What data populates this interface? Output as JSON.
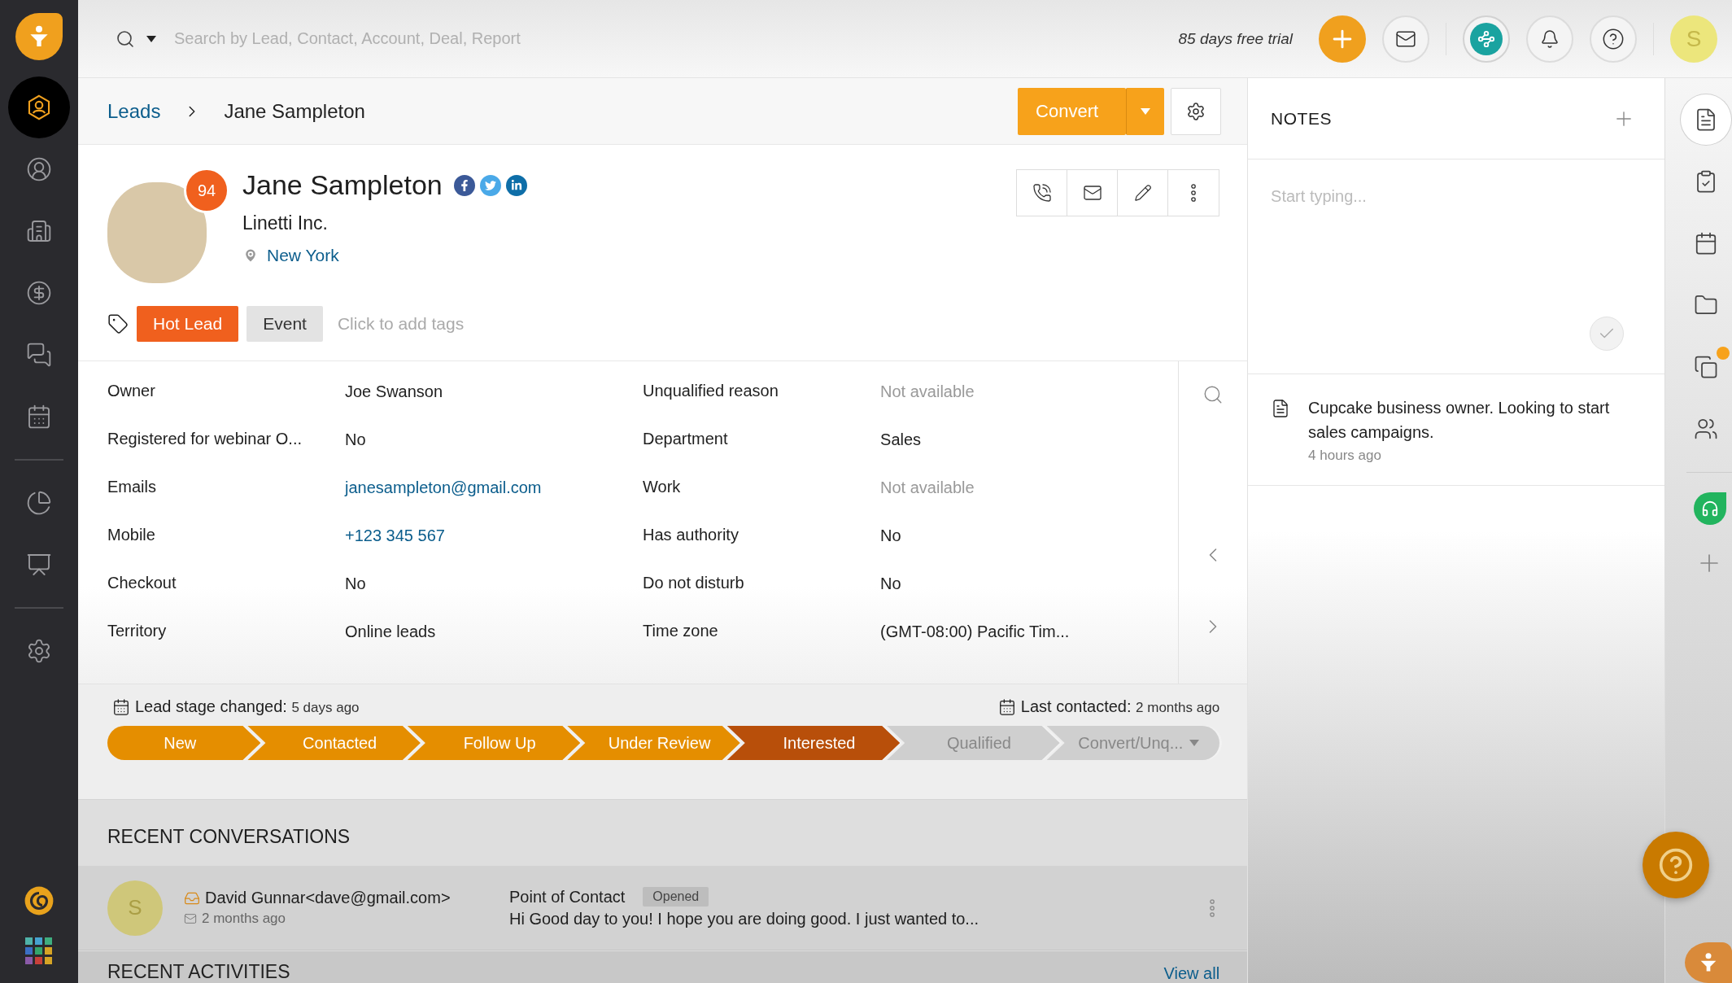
{
  "sidebar": {
    "items": [
      {
        "kind": "leads",
        "selected": true
      },
      {
        "kind": "contacts",
        "selected": false
      },
      {
        "kind": "accounts",
        "selected": false
      },
      {
        "kind": "deals",
        "selected": false
      },
      {
        "kind": "conversations",
        "selected": false
      },
      {
        "kind": "calendar",
        "selected": false
      },
      {
        "kind": "reports",
        "selected": false
      },
      {
        "kind": "analytics",
        "selected": false
      },
      {
        "kind": "settings",
        "selected": false
      }
    ]
  },
  "search": {
    "placeholder": "Search by Lead, Contact, Account, Deal, Report"
  },
  "trial_text": "85 days free trial",
  "user_initial": "S",
  "breadcrumb": [
    "Leads",
    "Jane Sampleton"
  ],
  "convert_button": "Convert",
  "lead": {
    "name": "Jane Sampleton",
    "score": "94",
    "company": "Linetti Inc.",
    "location": "New York"
  },
  "tags": [
    {
      "label": "Hot Lead",
      "color": "#f0601e"
    },
    {
      "label": "Event",
      "color": "#e3e3e3"
    }
  ],
  "tags_placeholder": "Click to add tags",
  "details": {
    "columns": [
      [
        {
          "label": "Owner",
          "value": "Joe Swanson",
          "kind": "text"
        },
        {
          "label": "Registered for webinar O...",
          "value": "No",
          "kind": "text"
        },
        {
          "label": "Emails",
          "value": "janesampleton@gmail.com",
          "kind": "link"
        },
        {
          "label": "Mobile",
          "value": "+123 345 567",
          "kind": "link"
        },
        {
          "label": "Checkout",
          "value": "No",
          "kind": "text"
        },
        {
          "label": "Territory",
          "value": "Online leads",
          "kind": "text"
        }
      ],
      [
        {
          "label": "Unqualified reason",
          "value": "Not available",
          "kind": "muted"
        },
        {
          "label": "Department",
          "value": "Sales",
          "kind": "text"
        },
        {
          "label": "Work",
          "value": "Not available",
          "kind": "muted"
        },
        {
          "label": "Has authority",
          "value": "No",
          "kind": "text"
        },
        {
          "label": "Do not disturb",
          "value": "No",
          "kind": "text"
        },
        {
          "label": "Time zone",
          "value": "(GMT-08:00) Pacific Tim...",
          "kind": "text"
        }
      ]
    ]
  },
  "stage_info": [
    {
      "label": "Lead stage changed:",
      "value": "5 days ago"
    },
    {
      "label": "Last contacted:",
      "value": "2 months ago"
    }
  ],
  "stages": [
    {
      "label": "New",
      "completed": true,
      "selected": false,
      "dropdown": false
    },
    {
      "label": "Contacted",
      "completed": true,
      "selected": false,
      "dropdown": false
    },
    {
      "label": "Follow Up",
      "completed": true,
      "selected": false,
      "dropdown": false
    },
    {
      "label": "Under Review",
      "completed": true,
      "selected": false,
      "dropdown": false
    },
    {
      "label": "Interested",
      "completed": true,
      "selected": true,
      "dropdown": false
    },
    {
      "label": "Qualified",
      "completed": false,
      "selected": false,
      "dropdown": false
    },
    {
      "label": "Convert/Unq...",
      "completed": false,
      "selected": false,
      "dropdown": true
    }
  ],
  "conversations": {
    "title": "RECENT CONVERSATIONS",
    "items": [
      {
        "avatar": "S",
        "sender": "David Gunnar<dave@gmail.com>",
        "time": "2 months ago",
        "subject": "Point of Contact",
        "status": "Opened",
        "snippet": "Hi  Good day to you! I hope you are doing good.  I just wanted to..."
      }
    ]
  },
  "activities": {
    "title": "RECENT ACTIVITIES",
    "link": "View all"
  },
  "notes": {
    "title": "NOTES",
    "placeholder": "Start typing...",
    "items": [
      {
        "text": "Cupcake business owner. Looking to start sales campaigns.",
        "time": "4 hours ago"
      }
    ]
  },
  "rail": {
    "items": [
      {
        "kind": "notes",
        "selected": true,
        "badge": false
      },
      {
        "kind": "tasks",
        "selected": false,
        "badge": false
      },
      {
        "kind": "calendar",
        "selected": false,
        "badge": false
      },
      {
        "kind": "files",
        "selected": false,
        "badge": false
      },
      {
        "kind": "copies",
        "selected": false,
        "badge": true
      },
      {
        "kind": "people",
        "selected": false,
        "badge": false
      }
    ]
  }
}
